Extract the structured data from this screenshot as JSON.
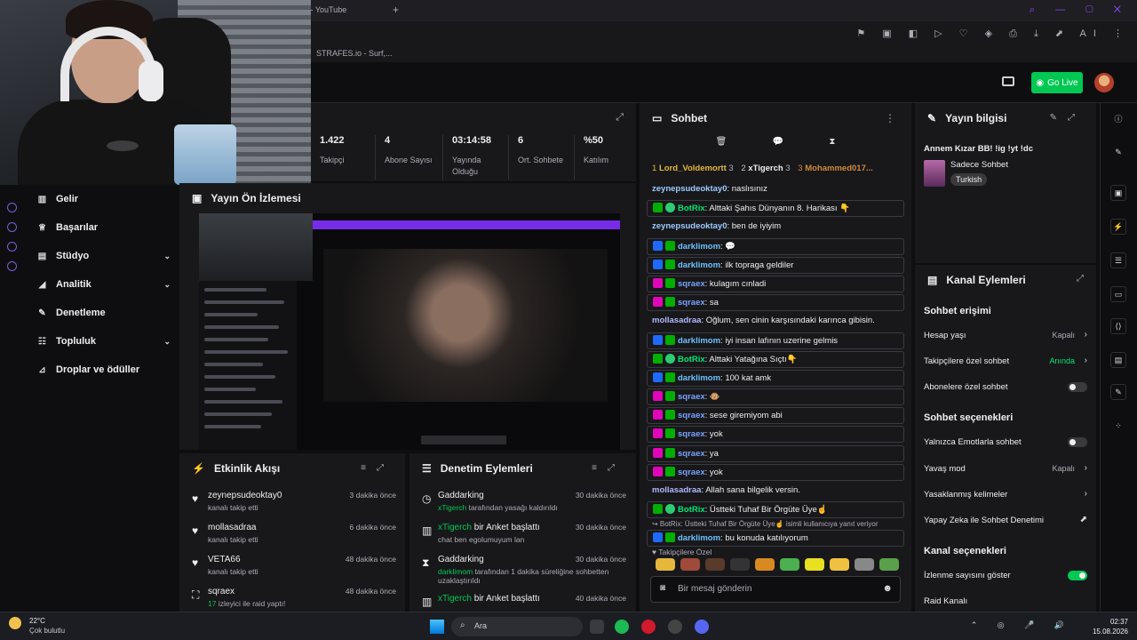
{
  "browser": {
    "tab_title": "r - YouTube",
    "bookmark": "STRAFES.io - Surf,..."
  },
  "topnav": {
    "go_live": "Go Live"
  },
  "stats": {
    "items": [
      {
        "value": "1.422",
        "label": "Takipçi"
      },
      {
        "value": "4",
        "label": "Abone Sayısı"
      },
      {
        "value": "03:14:58",
        "label": "Yayında Olduğu"
      },
      {
        "value": "6",
        "label": "Ort. Sohbete"
      },
      {
        "value": "%50",
        "label": "Katılım"
      }
    ]
  },
  "sidebar": {
    "items": [
      {
        "label": "Gelir",
        "icon": "chart-icon",
        "chevron": false
      },
      {
        "label": "Başarılar",
        "icon": "trophy-icon",
        "chevron": false
      },
      {
        "label": "Stüdyo",
        "icon": "studio-icon",
        "chevron": true
      },
      {
        "label": "Analitik",
        "icon": "analytics-icon",
        "chevron": true
      },
      {
        "label": "Denetleme",
        "icon": "wrench-icon",
        "chevron": false
      },
      {
        "label": "Topluluk",
        "icon": "community-icon",
        "chevron": true
      },
      {
        "label": "Droplar ve ödüller",
        "icon": "drops-icon",
        "chevron": false
      }
    ]
  },
  "preview": {
    "title": "Yayın Ön İzlemesi"
  },
  "activity": {
    "title": "Etkinlik Akışı",
    "items": [
      {
        "name": "zeynepsudeoktay0",
        "sub": "kanalı takip etti",
        "time": "3 dakika önce",
        "icon": "heart-icon"
      },
      {
        "name": "mollasadraa",
        "sub": "kanalı takip etti",
        "time": "6 dakika önce",
        "icon": "heart-icon"
      },
      {
        "name": "VETA66",
        "sub": "kanalı takip etti",
        "time": "48 dakika önce",
        "icon": "heart-icon"
      },
      {
        "name": "sqraex",
        "sub_green": "17",
        "sub": " izleyici ile raid yaptı!",
        "time": "48 dakika önce",
        "icon": "raid-icon"
      }
    ]
  },
  "modactions": {
    "title": "Denetim Eylemleri",
    "items": [
      {
        "name": "Gaddarking",
        "name_suffix": "",
        "sub_green": "xTigerch",
        "sub": " tarafından yasağı kaldırıldı",
        "time": "30 dakika önce",
        "icon": "clock-icon"
      },
      {
        "name": "xTigerch",
        "name_suffix": " bir Anket başlattı",
        "sub_green": "",
        "sub": "chat ben egolumuyum lan",
        "time": "30 dakika önce",
        "icon": "poll-icon"
      },
      {
        "name": "Gaddarking",
        "name_suffix": "",
        "sub_green": "darklimom",
        "sub": " tarafından 1 dakika süreliğine sohbetten uzaklaştırıldı",
        "time": "30 dakika önce",
        "icon": "hourglass-icon"
      },
      {
        "name": "xTigerch",
        "name_suffix": " bir Anket başlattı",
        "sub_green": "",
        "sub": "",
        "time": "40 dakika önce",
        "icon": "poll-icon"
      }
    ]
  },
  "chat": {
    "title": "Sohbet",
    "leaders": [
      {
        "rank": "1",
        "name": "Lord_Voldemortt",
        "count": "3",
        "color": "#e5b73b"
      },
      {
        "rank": "2",
        "name": "xTigerch",
        "count": "3",
        "color": "#c0c0c8"
      },
      {
        "rank": "3",
        "name": "Mohammed017...",
        "count": "",
        "color": "#d08a3a"
      }
    ],
    "messages": [
      {
        "user": "zeynepsudeoktay0",
        "text": ": naslısınız",
        "cls": "zp",
        "badges": [],
        "boxed": false
      },
      {
        "user": "BotRix",
        "text": ": Alttaki Şahıs Dünyanın 8. Harikası 👇",
        "cls": "bot",
        "badges": [
          "mod",
          "ok"
        ],
        "boxed": true
      },
      {
        "user": "zeynepsudeoktay0",
        "text": ": ben de iyiyim",
        "cls": "zp",
        "badges": [],
        "boxed": false
      },
      {
        "user": "darklimom",
        "text": ": 💬",
        "cls": "dl",
        "badges": [
          "sub",
          "mod"
        ],
        "boxed": true
      },
      {
        "user": "darklimom",
        "text": ": ilk topraga geldiler",
        "cls": "dl",
        "badges": [
          "sub",
          "mod"
        ],
        "boxed": true
      },
      {
        "user": "sqraex",
        "text": ": kulagım cınladi",
        "cls": "sq",
        "badges": [
          "vip",
          "mod"
        ],
        "boxed": true
      },
      {
        "user": "sqraex",
        "text": ": sa",
        "cls": "sq",
        "badges": [
          "vip",
          "mod"
        ],
        "boxed": true
      },
      {
        "user": "mollasadraa",
        "text": ": Oğlum, sen cinin karşısındaki karınca gibisin.",
        "cls": "mo",
        "badges": [],
        "boxed": false
      },
      {
        "user": "darklimom",
        "text": ": iyi insan lafının uzerine gelmis",
        "cls": "dl",
        "badges": [
          "sub",
          "mod"
        ],
        "boxed": true
      },
      {
        "user": "BotRix",
        "text": ": Alttaki Yatağına Sıçtı👇",
        "cls": "bot",
        "badges": [
          "mod",
          "ok"
        ],
        "boxed": true
      },
      {
        "user": "darklimom",
        "text": ": 100 kat amk",
        "cls": "dl",
        "badges": [
          "sub",
          "mod"
        ],
        "boxed": true
      },
      {
        "user": "sqraex",
        "text": ": 🐵",
        "cls": "sq",
        "badges": [
          "vip",
          "mod"
        ],
        "boxed": true
      },
      {
        "user": "sqraex",
        "text": ": sese giremiyom abi",
        "cls": "sq",
        "badges": [
          "vip",
          "mod"
        ],
        "boxed": true
      },
      {
        "user": "sqraex",
        "text": ": yok",
        "cls": "sq",
        "badges": [
          "vip",
          "mod"
        ],
        "boxed": true
      },
      {
        "user": "sqraex",
        "text": ": ya",
        "cls": "sq",
        "badges": [
          "vip",
          "mod"
        ],
        "boxed": true
      },
      {
        "user": "sqraex",
        "text": ": yok",
        "cls": "sq",
        "badges": [
          "vip",
          "mod"
        ],
        "boxed": true
      },
      {
        "user": "mollasadraa",
        "text": ": Allah sana bilgelik versin.",
        "cls": "mo",
        "badges": [],
        "boxed": false
      },
      {
        "user": "BotRix",
        "text": ": Üstteki Tuhaf Bir Örgüte Üye☝",
        "cls": "bot",
        "badges": [
          "mod",
          "ok"
        ],
        "boxed": true
      }
    ],
    "reply": "↪ BotRix: Üstteki Tuhaf Bir Örgüte Üye☝ isimli kullanıcıya yanıt veriyor",
    "reply_msg": {
      "user": "darklimom",
      "text": ": bu konuda katılıyorum",
      "cls": "dl",
      "badges": [
        "sub",
        "mod"
      ],
      "boxed": true
    },
    "followers_only": "Takipçilere Özel",
    "input_placeholder": "Bir mesaj gönderin"
  },
  "info": {
    "title": "Yayın bilgisi",
    "stream_title": "Annem Kızar BB! !ig !yt !dc",
    "category": "Sadece Sohbet",
    "tag": "Turkish"
  },
  "actions": {
    "title": "Kanal Eylemleri",
    "sec1": "Sohbet erişimi",
    "hesap_yasi": "Hesap yaşı",
    "hesap_yasi_val": "Kapalı",
    "takipci": "Takipçilere özel sohbet",
    "takipci_val": "Anında",
    "abone": "Abonelere özel sohbet",
    "sec2": "Sohbet seçenekleri",
    "emote": "Yalnızca Emotlarla sohbet",
    "yavas": "Yavaş mod",
    "yavas_val": "Kapalı",
    "yasak": "Yasaklanmış kelimeler",
    "ai": "Yapay Zeka ile Sohbet Denetimi",
    "sec3": "Kanal seçenekleri",
    "izlenme": "İzlenme sayısını göster",
    "raid": "Raid Kanalı"
  },
  "taskbar": {
    "temp": "22°C",
    "cond": "Çok bulutlu",
    "search": "Ara",
    "time": "02:37",
    "date": "15.08.2026"
  }
}
